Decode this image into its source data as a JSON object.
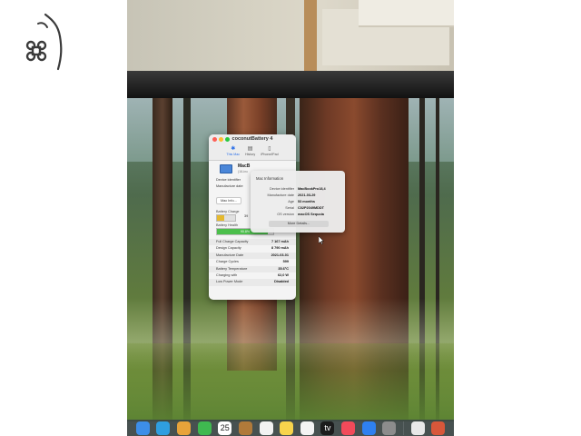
{
  "colors": {
    "accent": "#2a6ee8",
    "charge": "#e5b92e",
    "health": "#4cbf4c",
    "traffic_red": "#fe5f57",
    "traffic_yellow": "#febc2e",
    "traffic_green": "#28c840",
    "logo": "#3a3a3a"
  },
  "logo": {
    "icon": "apple-cloverleaf-logo"
  },
  "window": {
    "title": "coconutBattery 4",
    "tabs": [
      {
        "label": "This Mac",
        "icon": "battery-icon",
        "active": true
      },
      {
        "label": "History",
        "icon": "history-icon",
        "active": false
      },
      {
        "label": "iPhone/iPad",
        "icon": "phone-icon",
        "active": false
      }
    ],
    "device": {
      "name": "MacB",
      "subtitle": "(16-inc",
      "icon": "laptop-icon"
    },
    "lines": [
      "Device identifier",
      "Manufacture date"
    ],
    "mac_info_button": "Mac Info...",
    "battery_charge_label": "Battery Charge",
    "battery_charge_value": "39",
    "battery_charge_fraction": 0.39,
    "battery_health_label": "Battery Health",
    "battery_health_value": "90.8%",
    "battery_health_fraction": 0.908,
    "details": [
      {
        "key": "Full Charge Capacity",
        "value": "7 167 mAh"
      },
      {
        "key": "Design Capacity",
        "value": "8 790 mAh"
      },
      {
        "key": "Manufacture Date",
        "value": "2021-03-01"
      },
      {
        "key": "Charge Cycles",
        "value": "599"
      },
      {
        "key": "Battery Temperature",
        "value": "35.6°C"
      },
      {
        "key": "Charging with",
        "value": "62,0 W"
      },
      {
        "key": "Low Power Mode",
        "value": "Disabled"
      }
    ]
  },
  "popover": {
    "title": "Mac Information",
    "rows": [
      {
        "key": "Device identifier",
        "value": "MacBookPro18,4"
      },
      {
        "key": "Manufacture date",
        "value": "2021-03-29"
      },
      {
        "key": "Age",
        "value": "53 months"
      },
      {
        "key": "Serial",
        "value": "C02P2049MDDT"
      },
      {
        "key": "OS version",
        "value": "macOS Sequoia"
      }
    ],
    "button": "More Details..."
  },
  "dock": [
    {
      "icon": "finder-icon",
      "color": "#3d8ee8",
      "label": ""
    },
    {
      "icon": "safari-icon",
      "color": "#2f9ee0",
      "label": ""
    },
    {
      "icon": "photos-icon",
      "color": "#e8a33a",
      "label": ""
    },
    {
      "icon": "facetime-icon",
      "color": "#3fb950",
      "label": ""
    },
    {
      "icon": "calendar-icon",
      "color": "#ffffff",
      "label": "25"
    },
    {
      "icon": "folder-icon",
      "color": "#b07a3a",
      "label": ""
    },
    {
      "icon": "reminders-icon",
      "color": "#f2f2f2",
      "label": ""
    },
    {
      "icon": "notes-icon",
      "color": "#f7d44c",
      "label": ""
    },
    {
      "icon": "freeform-icon",
      "color": "#f4f4f4",
      "label": ""
    },
    {
      "icon": "appletv-icon",
      "color": "#1c1c1c",
      "label": "tv"
    },
    {
      "icon": "music-icon",
      "color": "#f24a5a",
      "label": ""
    },
    {
      "icon": "appstore-icon",
      "color": "#2f80f0",
      "label": ""
    },
    {
      "icon": "settings-icon",
      "color": "#8c8c8c",
      "label": ""
    },
    {
      "icon": "separator-icon",
      "color": "#5c6464",
      "label": ""
    },
    {
      "icon": "coconut-icon",
      "color": "#e8e8e8",
      "label": ""
    },
    {
      "icon": "app-icon",
      "color": "#d8573a",
      "label": ""
    }
  ]
}
